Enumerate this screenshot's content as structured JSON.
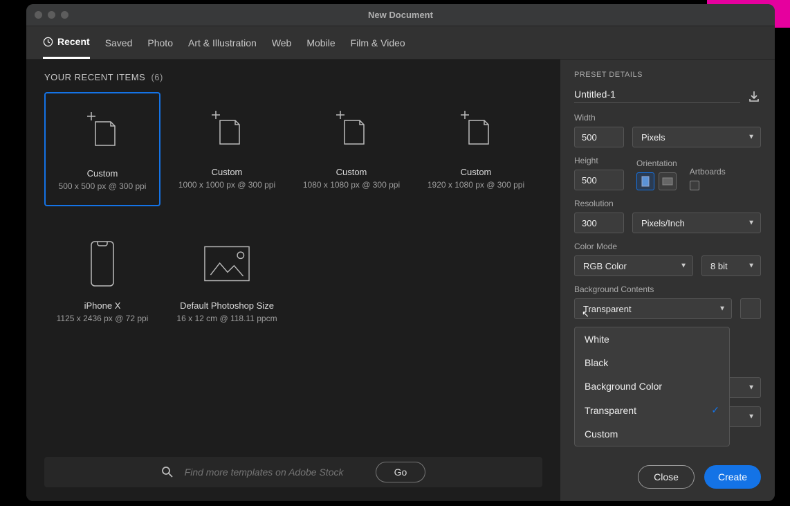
{
  "window": {
    "title": "New Document"
  },
  "tabs": [
    "Recent",
    "Saved",
    "Photo",
    "Art & Illustration",
    "Web",
    "Mobile",
    "Film & Video"
  ],
  "recent": {
    "headerLabel": "YOUR RECENT ITEMS",
    "count": "(6)",
    "items": [
      {
        "title": "Custom",
        "sub": "500 x 500 px @ 300 ppi",
        "kind": "doc"
      },
      {
        "title": "Custom",
        "sub": "1000 x 1000 px @ 300 ppi",
        "kind": "doc"
      },
      {
        "title": "Custom",
        "sub": "1080 x 1080 px @ 300 ppi",
        "kind": "doc"
      },
      {
        "title": "Custom",
        "sub": "1920 x 1080 px @ 300 ppi",
        "kind": "doc"
      },
      {
        "title": "iPhone X",
        "sub": "1125 x 2436 px @ 72 ppi",
        "kind": "phone"
      },
      {
        "title": "Default Photoshop Size",
        "sub": "16 x 12 cm @ 118.11 ppcm",
        "kind": "image"
      }
    ]
  },
  "search": {
    "placeholder": "Find more templates on Adobe Stock",
    "go": "Go"
  },
  "details": {
    "header": "PRESET DETAILS",
    "name": "Untitled-1",
    "widthLabel": "Width",
    "width": "500",
    "widthUnit": "Pixels",
    "heightLabel": "Height",
    "height": "500",
    "orientationLabel": "Orientation",
    "artboardsLabel": "Artboards",
    "resolutionLabel": "Resolution",
    "resolution": "300",
    "resolutionUnit": "Pixels/Inch",
    "colorModeLabel": "Color Mode",
    "colorMode": "RGB Color",
    "bitDepth": "8 bit",
    "bgLabel": "Background Contents",
    "bgValue": "Transparent",
    "bgOptions": [
      "White",
      "Black",
      "Background Color",
      "Transparent",
      "Custom"
    ],
    "bgSelected": "Transparent"
  },
  "footer": {
    "close": "Close",
    "create": "Create"
  }
}
